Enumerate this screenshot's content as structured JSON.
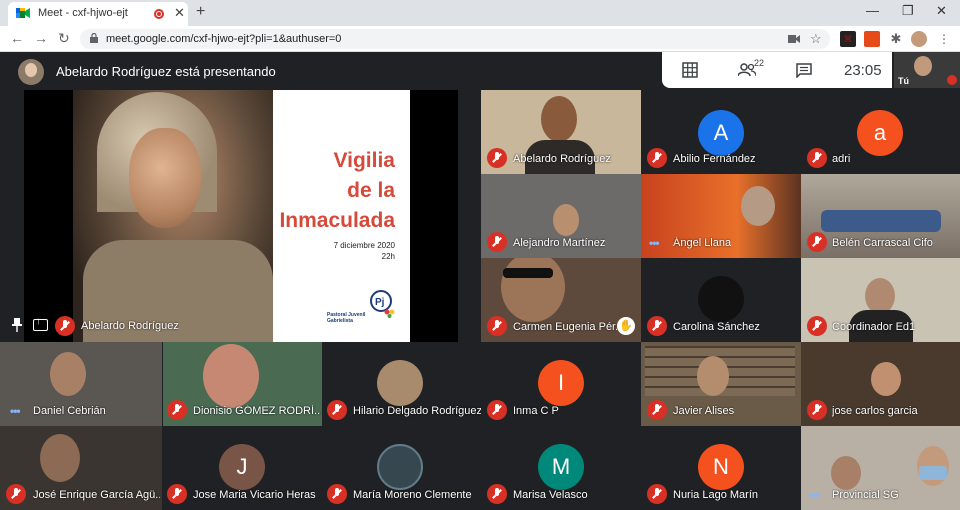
{
  "browser": {
    "tab_title": "Meet - cxf-hjwo-ejt",
    "tab_close": "✕",
    "new_tab": "+",
    "url": "meet.google.com/cxf-hjwo-ejt?pli=1&authuser=0",
    "win_min": "—",
    "win_max": "❐",
    "win_close": "✕",
    "back": "←",
    "forward": "→",
    "reload": "↻",
    "star": "☆",
    "menu": "⋮"
  },
  "meet": {
    "presenting_text": "Abelardo Rodríguez está presentando",
    "people_count": "22",
    "clock": "23:05",
    "self_label": "Tú",
    "presentation": {
      "title": "Vigilia\nde la\nInmaculada",
      "date_line1": "7 diciembre 2020",
      "date_line2": "22h",
      "org_line1": "Pastoral Juvenil",
      "org_line2": "Gabrielista",
      "presenter_name": "Abelardo Rodríguez"
    },
    "participants": [
      {
        "name": "Abelardo Rodríguez"
      },
      {
        "name": "Abilio Fernández",
        "initial": "A"
      },
      {
        "name": "adri",
        "initial": "a"
      },
      {
        "name": "Alejandro Martínez"
      },
      {
        "name": "Ángel Llana"
      },
      {
        "name": "Belén Carrascal Cifo"
      },
      {
        "name": "Carmen Eugenia Pér..."
      },
      {
        "name": "Carolina Sánchez"
      },
      {
        "name": "Coordinador Ed1"
      },
      {
        "name": "Daniel Cebrián"
      },
      {
        "name": "Dionisio GÓMEZ RODRÍ..."
      },
      {
        "name": "Hilario Delgado Rodríguez"
      },
      {
        "name": "Inma C P",
        "initial": "I"
      },
      {
        "name": "Javier Alises"
      },
      {
        "name": "jose carlos garcia"
      },
      {
        "name": "José Enrique García Agü..."
      },
      {
        "name": "Jose Maria Vicario Heras",
        "initial": "J"
      },
      {
        "name": "María Moreno Clemente"
      },
      {
        "name": "Marisa Velasco",
        "initial": "M"
      },
      {
        "name": "Nuria Lago Marín",
        "initial": "N"
      },
      {
        "name": "Provincial SG"
      }
    ],
    "colors": {
      "avatar_blue": "#1a73e8",
      "avatar_orange": "#f4511e",
      "avatar_brown": "#795548",
      "avatar_teal": "#00897b",
      "muted_red": "#d93025",
      "slide_title": "#d54a3a"
    }
  }
}
